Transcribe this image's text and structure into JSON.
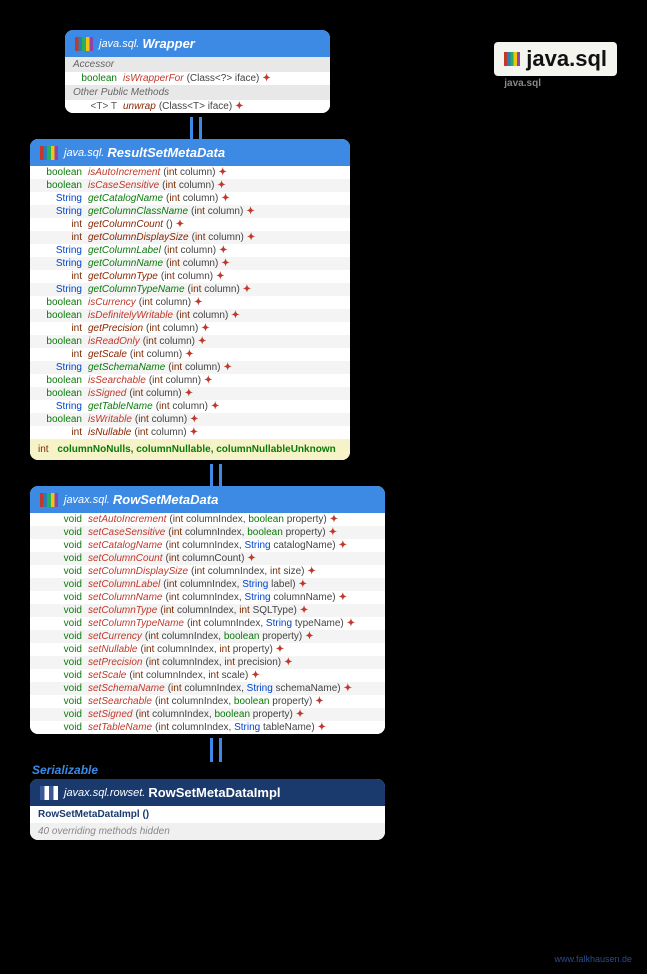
{
  "badge": {
    "title": "java.sql",
    "subtitle": "java.sql"
  },
  "footer": "www.falkhausen.de",
  "serializable": "Serializable",
  "wrapper": {
    "pkg": "java.sql.",
    "name": "Wrapper",
    "sec_accessor": "Accessor",
    "sec_other": "Other Public Methods",
    "m1": {
      "ret": "boolean",
      "name": "isWrapperFor",
      "params": "(Class<?> iface)"
    },
    "m2": {
      "ret": "<T> T",
      "name": "unwrap",
      "params": "(Class<T> iface)"
    }
  },
  "rsmd": {
    "pkg": "java.sql.",
    "name": "ResultSetMetaData",
    "constants_ret": "int",
    "constants": "columnNoNulls, columnNullable, columnNullableUnknown",
    "methods": [
      {
        "ret": "boolean",
        "rc": "ret-bool",
        "name": "isAutoIncrement",
        "mc": "m-red",
        "p": "(int column)"
      },
      {
        "ret": "boolean",
        "rc": "ret-bool",
        "name": "isCaseSensitive",
        "mc": "m-red",
        "p": "(int column)"
      },
      {
        "ret": "String",
        "rc": "ret-string",
        "name": "getCatalogName",
        "mc": "m-green",
        "p": "(int column)"
      },
      {
        "ret": "String",
        "rc": "ret-string",
        "name": "getColumnClassName",
        "mc": "m-green",
        "p": "(int column)"
      },
      {
        "ret": "int",
        "rc": "ret-int",
        "name": "getColumnCount",
        "mc": "m-darkred",
        "p": "()"
      },
      {
        "ret": "int",
        "rc": "ret-int",
        "name": "getColumnDisplaySize",
        "mc": "m-darkred",
        "p": "(int column)"
      },
      {
        "ret": "String",
        "rc": "ret-string",
        "name": "getColumnLabel",
        "mc": "m-green",
        "p": "(int column)"
      },
      {
        "ret": "String",
        "rc": "ret-string",
        "name": "getColumnName",
        "mc": "m-green",
        "p": "(int column)"
      },
      {
        "ret": "int",
        "rc": "ret-int",
        "name": "getColumnType",
        "mc": "m-darkred",
        "p": "(int column)"
      },
      {
        "ret": "String",
        "rc": "ret-string",
        "name": "getColumnTypeName",
        "mc": "m-green",
        "p": "(int column)"
      },
      {
        "ret": "boolean",
        "rc": "ret-bool",
        "name": "isCurrency",
        "mc": "m-red",
        "p": "(int column)"
      },
      {
        "ret": "boolean",
        "rc": "ret-bool",
        "name": "isDefinitelyWritable",
        "mc": "m-red",
        "p": "(int column)"
      },
      {
        "ret": "int",
        "rc": "ret-int",
        "name": "getPrecision",
        "mc": "m-darkred",
        "p": "(int column)"
      },
      {
        "ret": "boolean",
        "rc": "ret-bool",
        "name": "isReadOnly",
        "mc": "m-red",
        "p": "(int column)"
      },
      {
        "ret": "int",
        "rc": "ret-int",
        "name": "getScale",
        "mc": "m-darkred",
        "p": "(int column)"
      },
      {
        "ret": "String",
        "rc": "ret-string",
        "name": "getSchemaName",
        "mc": "m-green",
        "p": "(int column)"
      },
      {
        "ret": "boolean",
        "rc": "ret-bool",
        "name": "isSearchable",
        "mc": "m-red",
        "p": "(int column)"
      },
      {
        "ret": "boolean",
        "rc": "ret-bool",
        "name": "isSigned",
        "mc": "m-red",
        "p": "(int column)"
      },
      {
        "ret": "String",
        "rc": "ret-string",
        "name": "getTableName",
        "mc": "m-green",
        "p": "(int column)"
      },
      {
        "ret": "boolean",
        "rc": "ret-bool",
        "name": "isWritable",
        "mc": "m-red",
        "p": "(int column)"
      },
      {
        "ret": "int",
        "rc": "ret-int",
        "name": "isNullable",
        "mc": "m-darkred",
        "p": "(int column)"
      }
    ]
  },
  "rowset": {
    "pkg": "javax.sql.",
    "name": "RowSetMetaData",
    "methods": [
      {
        "ret": "void",
        "name": "setAutoIncrement",
        "p": "(int columnIndex, boolean property)"
      },
      {
        "ret": "void",
        "name": "setCaseSensitive",
        "p": "(int columnIndex, boolean property)"
      },
      {
        "ret": "void",
        "name": "setCatalogName",
        "p": "(int columnIndex, String catalogName)"
      },
      {
        "ret": "void",
        "name": "setColumnCount",
        "p": "(int columnCount)"
      },
      {
        "ret": "void",
        "name": "setColumnDisplaySize",
        "p": "(int columnIndex, int size)"
      },
      {
        "ret": "void",
        "name": "setColumnLabel",
        "p": "(int columnIndex, String label)"
      },
      {
        "ret": "void",
        "name": "setColumnName",
        "p": "(int columnIndex, String columnName)"
      },
      {
        "ret": "void",
        "name": "setColumnType",
        "p": "(int columnIndex, int SQLType)"
      },
      {
        "ret": "void",
        "name": "setColumnTypeName",
        "p": "(int columnIndex, String typeName)"
      },
      {
        "ret": "void",
        "name": "setCurrency",
        "p": "(int columnIndex, boolean property)"
      },
      {
        "ret": "void",
        "name": "setNullable",
        "p": "(int columnIndex, int property)"
      },
      {
        "ret": "void",
        "name": "setPrecision",
        "p": "(int columnIndex, int precision)"
      },
      {
        "ret": "void",
        "name": "setScale",
        "p": "(int columnIndex, int scale)"
      },
      {
        "ret": "void",
        "name": "setSchemaName",
        "p": "(int columnIndex, String schemaName)"
      },
      {
        "ret": "void",
        "name": "setSearchable",
        "p": "(int columnIndex, boolean property)"
      },
      {
        "ret": "void",
        "name": "setSigned",
        "p": "(int columnIndex, boolean property)"
      },
      {
        "ret": "void",
        "name": "setTableName",
        "p": "(int columnIndex, String tableName)"
      }
    ]
  },
  "impl": {
    "pkg": "javax.sql.rowset.",
    "name": "RowSetMetaDataImpl",
    "ctor": "RowSetMetaDataImpl ()",
    "overriding": "40 overriding methods hidden"
  }
}
